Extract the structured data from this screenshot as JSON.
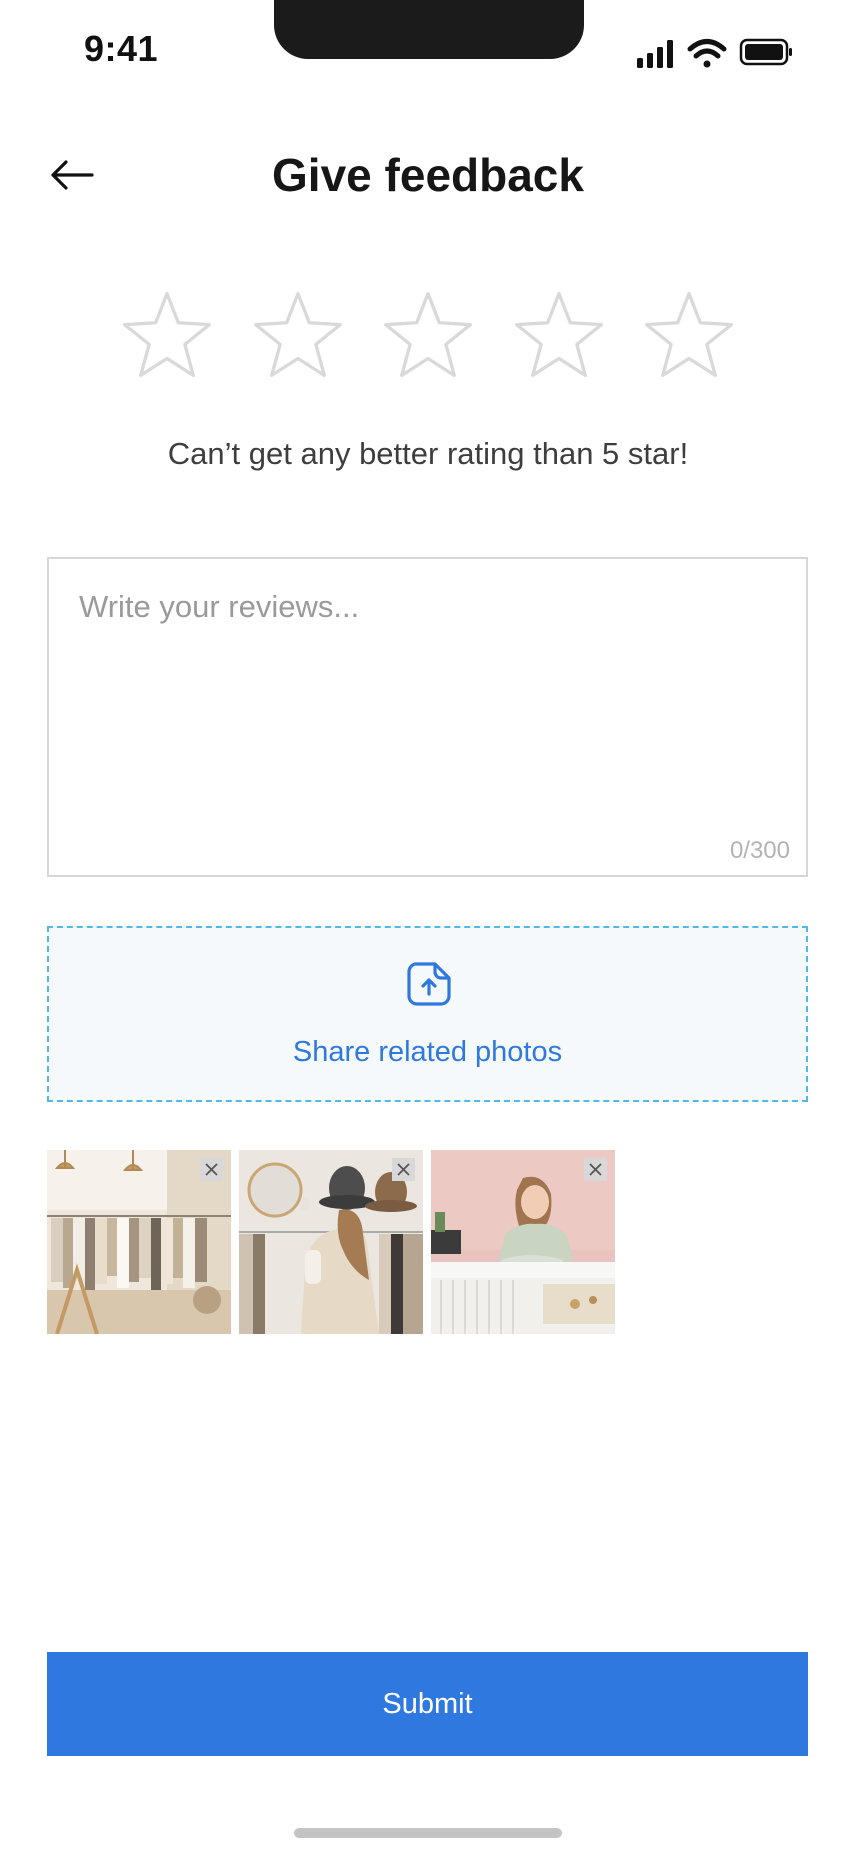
{
  "status_bar": {
    "time": "9:41",
    "icons": [
      "signal-icon",
      "wifi-icon",
      "battery-icon"
    ]
  },
  "header": {
    "title": "Give feedback",
    "back_icon": "arrow-left-icon"
  },
  "rating": {
    "max_stars": 5,
    "selected": 0,
    "hint": "Can’t get any better rating than 5 star!"
  },
  "review": {
    "value": "",
    "placeholder": "Write your reviews...",
    "counter": "0/300"
  },
  "upload": {
    "label": "Share related photos",
    "icon": "upload-icon"
  },
  "photos": [
    {
      "subject": "clothing-store-interior"
    },
    {
      "subject": "woman-browsing-clothing-rack"
    },
    {
      "subject": "shop-assistant-folding-clothes"
    }
  ],
  "submit": {
    "label": "Submit"
  },
  "colors": {
    "accent": "#2f78e0",
    "upload_border": "#54b8e6",
    "upload_bg": "#f5f9fc",
    "star_outline": "#d9d9d9"
  }
}
